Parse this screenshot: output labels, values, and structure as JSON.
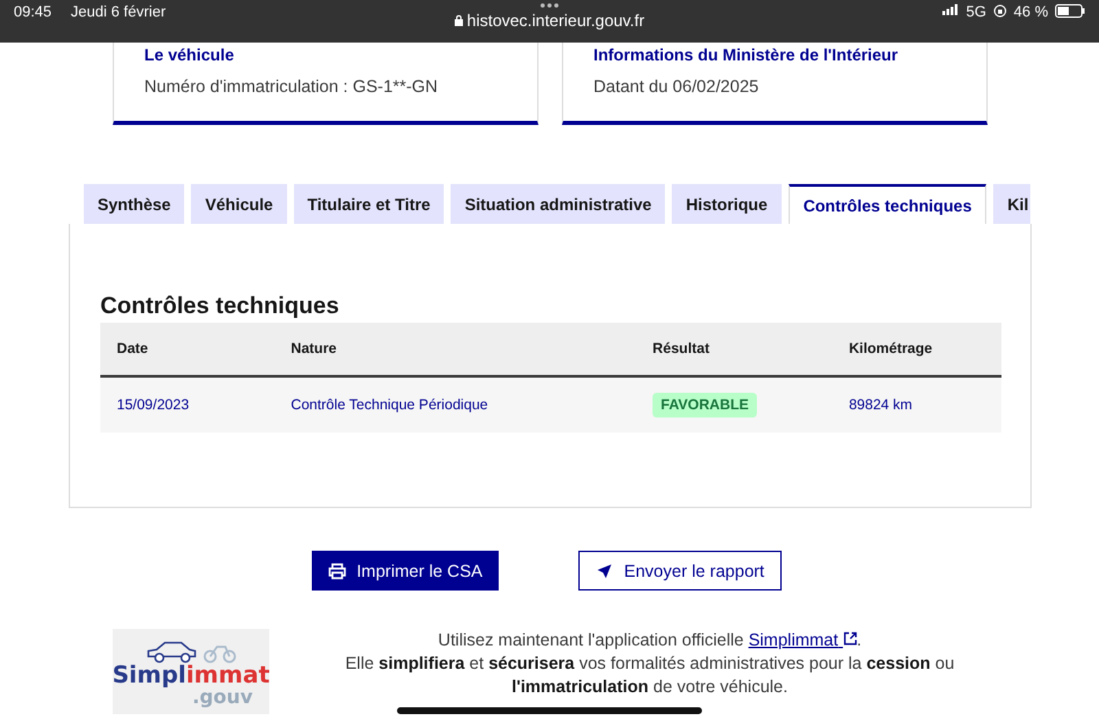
{
  "status_bar": {
    "time": "09:45",
    "date": "Jeudi 6 février",
    "url": "histovec.interieur.gouv.fr",
    "network": "5G",
    "battery": "46 %"
  },
  "cards": [
    {
      "title": "Le véhicule",
      "text": "Numéro d'immatriculation : GS-1**-GN"
    },
    {
      "title": "Informations du Ministère de l'Intérieur",
      "text": "Datant du 06/02/2025"
    }
  ],
  "tabs": [
    {
      "label": "Synthèse",
      "selected": false
    },
    {
      "label": "Véhicule",
      "selected": false
    },
    {
      "label": "Titulaire et Titre",
      "selected": false
    },
    {
      "label": "Situation administrative",
      "selected": false
    },
    {
      "label": "Historique",
      "selected": false
    },
    {
      "label": "Contrôles techniques",
      "selected": true
    },
    {
      "label": "Kil",
      "selected": false
    }
  ],
  "section_title": "Contrôles techniques",
  "table": {
    "columns": [
      "Date",
      "Nature",
      "Résultat",
      "Kilométrage"
    ],
    "rows": [
      {
        "date": "15/09/2023",
        "nature": "Contrôle Technique Périodique",
        "result": "FAVORABLE",
        "mileage": "89824 km"
      }
    ]
  },
  "buttons": [
    {
      "label": "Imprimer le CSA",
      "kind": "primary"
    },
    {
      "label": "Envoyer le rapport",
      "kind": "secondary"
    }
  ],
  "promo": {
    "logo_part1": "Simpl",
    "logo_part2": "immat",
    "logo_part3": ".gouv",
    "text_before": "Utilisez maintenant l'application officielle ",
    "link": "Simplimmat",
    "text_after": ".",
    "text_second": "Elle **simplifiera** et **sécurisera** vos formalités administratives pour la **cession** ou **l'immatriculation** de votre véhicule."
  }
}
